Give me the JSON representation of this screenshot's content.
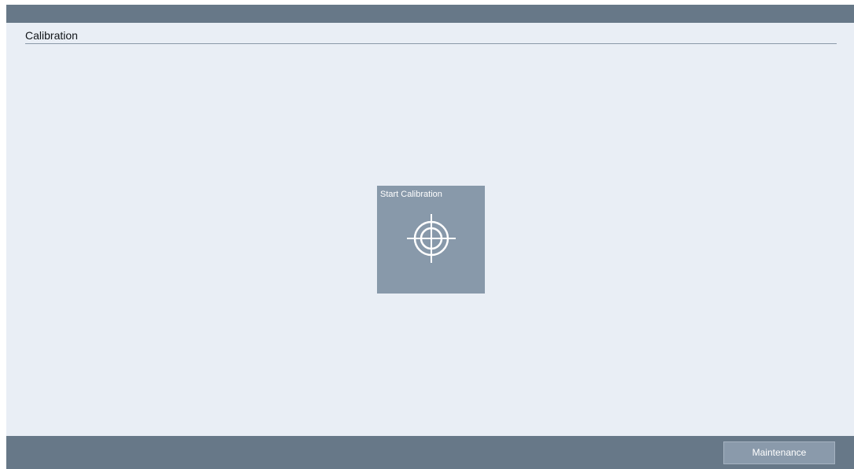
{
  "header": {
    "title": "Calibration"
  },
  "main": {
    "tile": {
      "label": "Start Calibration",
      "icon": "crosshair-target-icon"
    }
  },
  "footer": {
    "maintenance_label": "Maintenance"
  },
  "colors": {
    "bar": "#677888",
    "background": "#e9eef5",
    "tile": "#8899aa",
    "button": "#8a9aab"
  }
}
